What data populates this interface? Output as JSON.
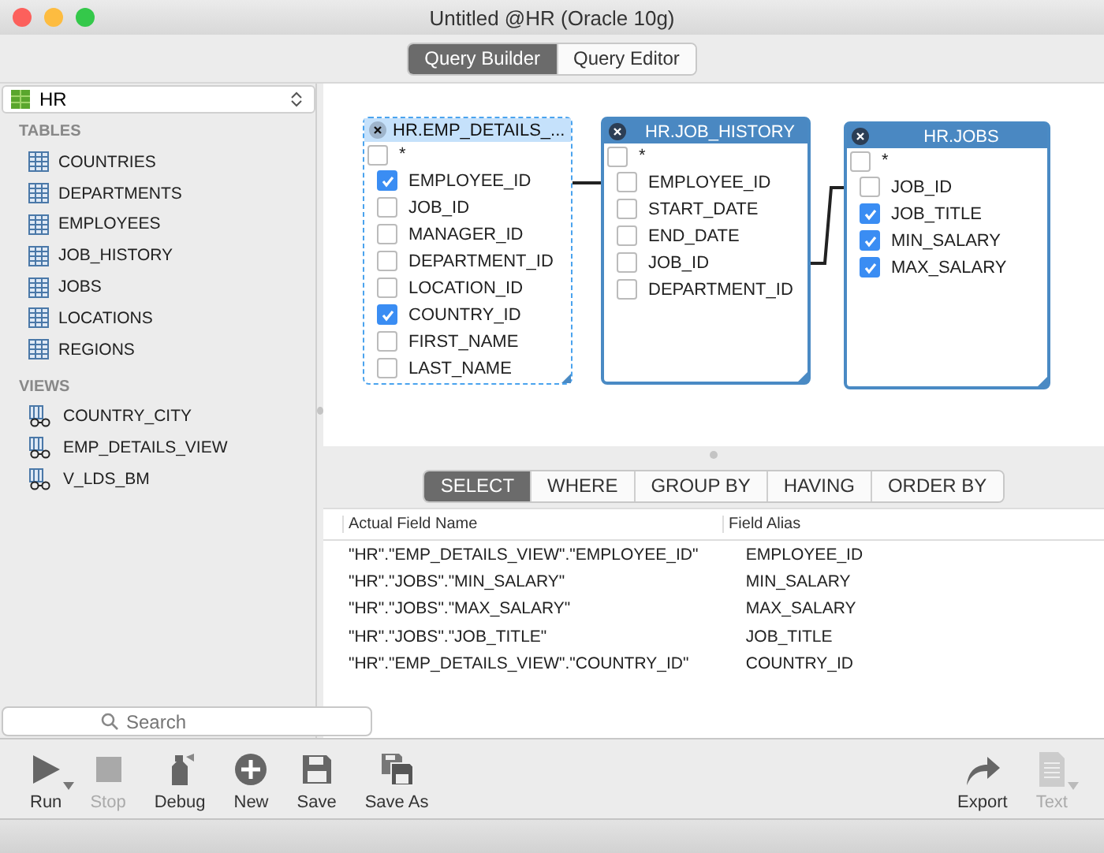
{
  "window": {
    "title": "Untitled @HR (Oracle 10g)"
  },
  "view_tabs": [
    {
      "label": "Query Builder",
      "selected": true
    },
    {
      "label": "Query Editor",
      "selected": false
    }
  ],
  "schema_selector": {
    "value": "HR"
  },
  "sidebar": {
    "sections": [
      {
        "heading": "TABLES",
        "items": [
          {
            "label": "COUNTRIES",
            "kind": "table"
          },
          {
            "label": "DEPARTMENTS",
            "kind": "table"
          },
          {
            "label": "EMPLOYEES",
            "kind": "table"
          },
          {
            "label": "JOB_HISTORY",
            "kind": "table"
          },
          {
            "label": "JOBS",
            "kind": "table"
          },
          {
            "label": "LOCATIONS",
            "kind": "table"
          },
          {
            "label": "REGIONS",
            "kind": "table"
          }
        ]
      },
      {
        "heading": "VIEWS",
        "items": [
          {
            "label": "COUNTRY_CITY",
            "kind": "view"
          },
          {
            "label": "EMP_DETAILS_VIEW",
            "kind": "view"
          },
          {
            "label": "V_LDS_BM",
            "kind": "view"
          }
        ]
      }
    ]
  },
  "search": {
    "placeholder": "Search"
  },
  "diagram": {
    "tables": [
      {
        "title": "HR.EMP_DETAILS_...",
        "selected": true,
        "fields": [
          {
            "name": "*",
            "checked": false
          },
          {
            "name": "EMPLOYEE_ID",
            "checked": true
          },
          {
            "name": "JOB_ID",
            "checked": false
          },
          {
            "name": "MANAGER_ID",
            "checked": false
          },
          {
            "name": "DEPARTMENT_ID",
            "checked": false
          },
          {
            "name": "LOCATION_ID",
            "checked": false
          },
          {
            "name": "COUNTRY_ID",
            "checked": true
          },
          {
            "name": "FIRST_NAME",
            "checked": false
          },
          {
            "name": "LAST_NAME",
            "checked": false
          }
        ]
      },
      {
        "title": "HR.JOB_HISTORY",
        "selected": false,
        "fields": [
          {
            "name": "*",
            "checked": false
          },
          {
            "name": "EMPLOYEE_ID",
            "checked": false
          },
          {
            "name": "START_DATE",
            "checked": false
          },
          {
            "name": "END_DATE",
            "checked": false
          },
          {
            "name": "JOB_ID",
            "checked": false
          },
          {
            "name": "DEPARTMENT_ID",
            "checked": false
          }
        ]
      },
      {
        "title": "HR.JOBS",
        "selected": false,
        "fields": [
          {
            "name": "*",
            "checked": false
          },
          {
            "name": "JOB_ID",
            "checked": false
          },
          {
            "name": "JOB_TITLE",
            "checked": true
          },
          {
            "name": "MIN_SALARY",
            "checked": true
          },
          {
            "name": "MAX_SALARY",
            "checked": true
          }
        ]
      }
    ]
  },
  "clause_tabs": [
    {
      "label": "SELECT",
      "selected": true
    },
    {
      "label": "WHERE",
      "selected": false
    },
    {
      "label": "GROUP BY",
      "selected": false
    },
    {
      "label": "HAVING",
      "selected": false
    },
    {
      "label": "ORDER BY",
      "selected": false
    }
  ],
  "fields_table": {
    "columns": [
      "Actual Field Name",
      "Field Alias"
    ],
    "rows": [
      [
        "\"HR\".\"EMP_DETAILS_VIEW\".\"EMPLOYEE_ID\"",
        "EMPLOYEE_ID"
      ],
      [
        "\"HR\".\"JOBS\".\"MIN_SALARY\"",
        "MIN_SALARY"
      ],
      [
        "\"HR\".\"JOBS\".\"MAX_SALARY\"",
        "MAX_SALARY"
      ],
      [
        "\"HR\".\"JOBS\".\"JOB_TITLE\"",
        "JOB_TITLE"
      ],
      [
        "\"HR\".\"EMP_DETAILS_VIEW\".\"COUNTRY_ID\"",
        "COUNTRY_ID"
      ]
    ]
  },
  "toolbar": {
    "left": [
      {
        "label": "Run",
        "kind": "run",
        "disabled": false,
        "menu": true
      },
      {
        "label": "Stop",
        "kind": "stop",
        "disabled": true,
        "menu": false
      },
      {
        "label": "Debug",
        "kind": "debug",
        "disabled": false,
        "menu": false
      },
      {
        "label": "New",
        "kind": "new",
        "disabled": false,
        "menu": false
      },
      {
        "label": "Save",
        "kind": "save",
        "disabled": false,
        "menu": false
      },
      {
        "label": "Save As",
        "kind": "save_as",
        "disabled": false,
        "menu": false
      }
    ],
    "right": [
      {
        "label": "Export",
        "kind": "export",
        "disabled": false,
        "menu": false
      },
      {
        "label": "Text",
        "kind": "text",
        "disabled": true,
        "menu": true
      }
    ]
  }
}
